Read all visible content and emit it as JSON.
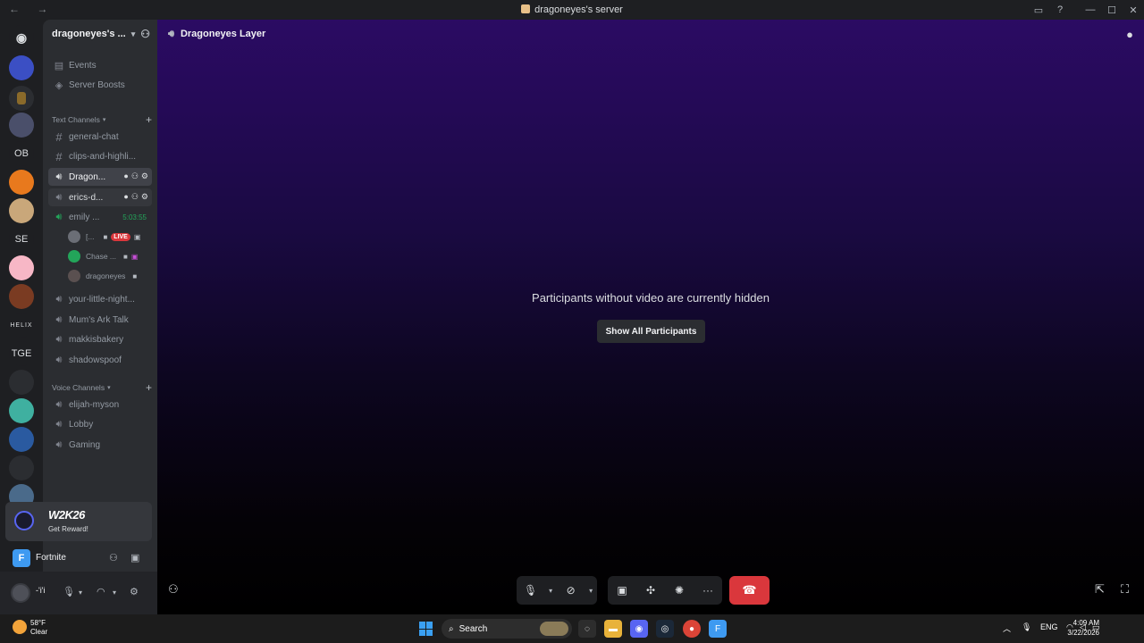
{
  "window": {
    "title": "dragoneyes's server",
    "nav": "← →"
  },
  "guilds": {
    "items": [
      "OB",
      "SE",
      "HELIX",
      "TGE"
    ]
  },
  "server": {
    "name": "dragoneyes's ..."
  },
  "sidebar": {
    "top_items": [
      "Events",
      "Server Boosts"
    ],
    "text_category": "Text Channels",
    "text_channels": [
      "general-chat",
      "clips-and-highli..."
    ],
    "voice_rooms": [
      {
        "label": "Dragon..."
      },
      {
        "label": "erics-d..."
      },
      {
        "label": "emily ...",
        "timer": "5:03:55"
      }
    ],
    "voice_users": [
      {
        "name": "[...",
        "live": "LIVE"
      },
      {
        "name": "Chase ..."
      },
      {
        "name": "dragoneyes"
      }
    ],
    "more_rooms": [
      "your-little-night...",
      "Mum's Ark Talk",
      "makkisbakery",
      "shadowspoof"
    ],
    "voice_category": "Voice Channels",
    "voice_channels": [
      "elijah-myson",
      "Lobby",
      "Gaming"
    ]
  },
  "promo": {
    "logo": "W2K26",
    "subtitle": "Get Reward!"
  },
  "activity": {
    "name": "Fortnite",
    "icon_letter": "F"
  },
  "user": {
    "name": "-'i'i"
  },
  "main": {
    "channel": "Dragoneyes Layer",
    "hidden_message": "Participants without video are currently hidden",
    "show_button": "Show All Participants"
  },
  "taskbar": {
    "temp": "58°F",
    "weather": "Clear",
    "search": "Search",
    "lang": "ENG",
    "time": "4:09 AM",
    "date": "3/22/2026"
  }
}
